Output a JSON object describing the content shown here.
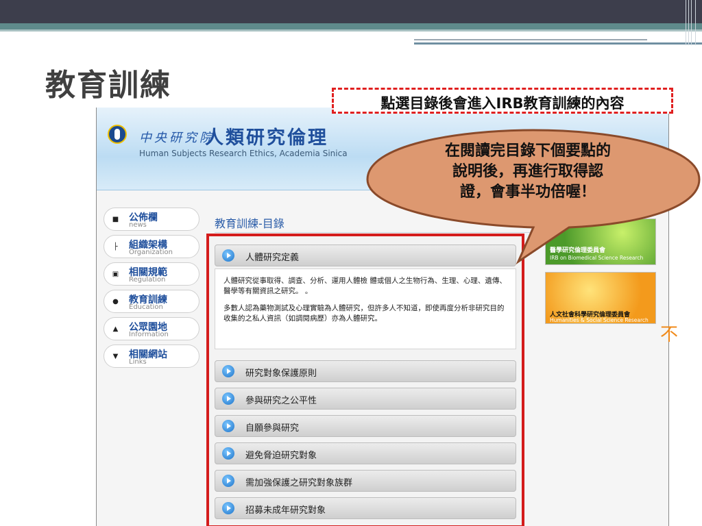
{
  "slide": {
    "title": "教育訓練",
    "callout": "點選目錄後會進入IRB教育訓練的內容",
    "bubble_lines": [
      "在閱讀完目錄下個要點的",
      "說明後，再進行取得認",
      "證，會事半功倍喔！"
    ],
    "orange_char": "不"
  },
  "site": {
    "brand": "中央研究院",
    "title": "人類研究倫理",
    "subtitle": "Human Subjects Research Ethics, Academia Sinica",
    "nav": [
      {
        "label": "公佈欄",
        "sub": "news",
        "icon": "speech-icon"
      },
      {
        "label": "組織架構",
        "sub": "Organization",
        "icon": "org-chart-icon"
      },
      {
        "label": "相關規範",
        "sub": "Regulation",
        "icon": "book-icon"
      },
      {
        "label": "教育訓練",
        "sub": "Education",
        "icon": "info-icon"
      },
      {
        "label": "公眾園地",
        "sub": "Information",
        "icon": "person-icon"
      },
      {
        "label": "相關網站",
        "sub": "Links",
        "icon": "download-icon"
      }
    ],
    "page_heading": "教育訓練-目錄",
    "accordion": [
      {
        "label": "人體研究定義",
        "expanded": true
      },
      {
        "label": "研究對象保護原則"
      },
      {
        "label": "參與研究之公平性"
      },
      {
        "label": "自願參與研究"
      },
      {
        "label": "避免脅迫研究對象"
      },
      {
        "label": "需加強保護之研究對象族群"
      },
      {
        "label": "招募未成年研究對象"
      }
    ],
    "content_paragraphs": [
      "人體研究從事取得、調查、分析、運用人體檢 體或個人之生物行為、生理、心理、遺傳、醫學等有關資訊之研究。 。",
      "多數人認為藥物測試及心理實驗為人體研究，但許多人不知道，即使再度分析非研究目的收集的之私人資訊（如調閱病歷）亦為人體研究。"
    ],
    "banners": [
      {
        "title": "醫學研究倫理委員會",
        "sub": "IRB on Biomedical Science Research"
      },
      {
        "title": "人文社會科學研究倫理委員會",
        "sub": "Humanities & Social Science Research"
      }
    ]
  }
}
